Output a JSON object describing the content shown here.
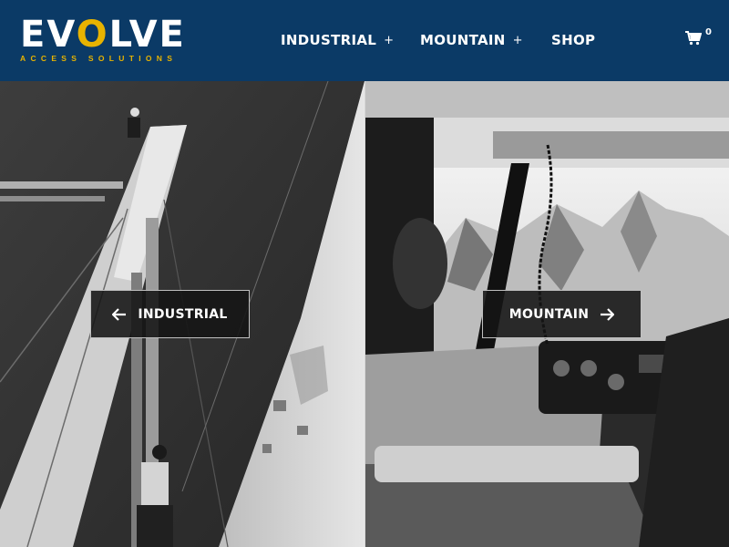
{
  "brand": {
    "logo_pre": "EV",
    "logo_accent": "O",
    "logo_post": "LVE",
    "tagline": "ACCESS SOLUTIONS",
    "primary_color": "#0b3a66",
    "accent_color": "#e8b300"
  },
  "nav": {
    "items": [
      {
        "label": "INDUSTRIAL",
        "expand": "+"
      },
      {
        "label": "MOUNTAIN",
        "expand": "+"
      },
      {
        "label": "SHOP"
      }
    ],
    "cart": {
      "icon": "cart-icon",
      "count": "0"
    }
  },
  "panels": {
    "industrial": {
      "button_label": "INDUSTRIAL",
      "icon": "arrow-left-icon",
      "image": "rope-access workers on structure"
    },
    "mountain": {
      "button_label": "MOUNTAIN",
      "icon": "arrow-right-icon",
      "image": "helicopter cockpit view of mountains"
    }
  }
}
